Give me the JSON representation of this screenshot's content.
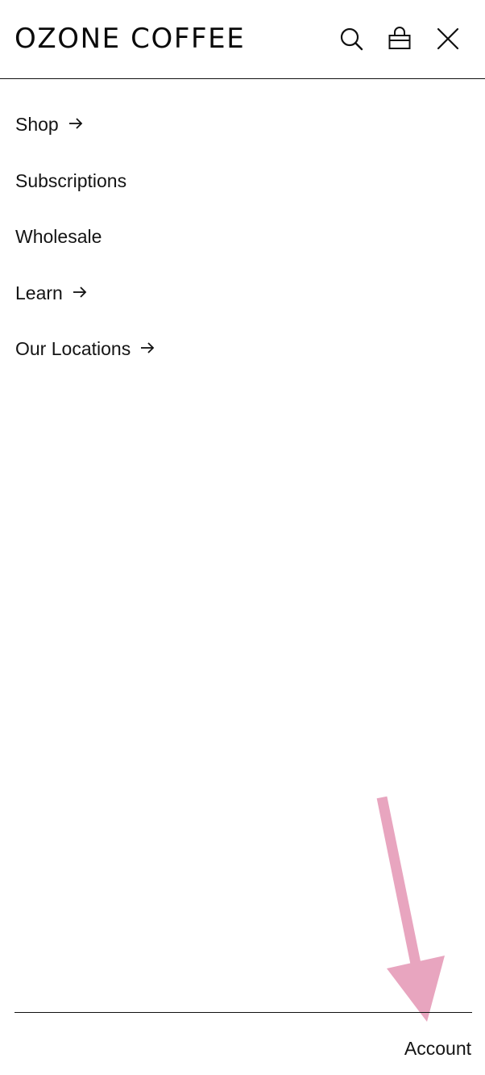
{
  "header": {
    "logo_text": "OZONE COFFEE",
    "icons": {
      "search": "search-icon",
      "bag": "shopping-bag-icon",
      "close": "close-icon"
    }
  },
  "nav": {
    "items": [
      {
        "label": "Shop",
        "has_arrow": true
      },
      {
        "label": "Subscriptions",
        "has_arrow": false
      },
      {
        "label": "Wholesale",
        "has_arrow": false
      },
      {
        "label": "Learn",
        "has_arrow": true
      },
      {
        "label": "Our Locations",
        "has_arrow": true
      }
    ]
  },
  "footer": {
    "account_label": "Account"
  },
  "annotation": {
    "arrow_color": "#E8A5BF",
    "arrow_icon": "pointer-arrow-icon"
  },
  "colors": {
    "text": "#141414",
    "background": "#FFFFFF",
    "divider": "#111111"
  }
}
